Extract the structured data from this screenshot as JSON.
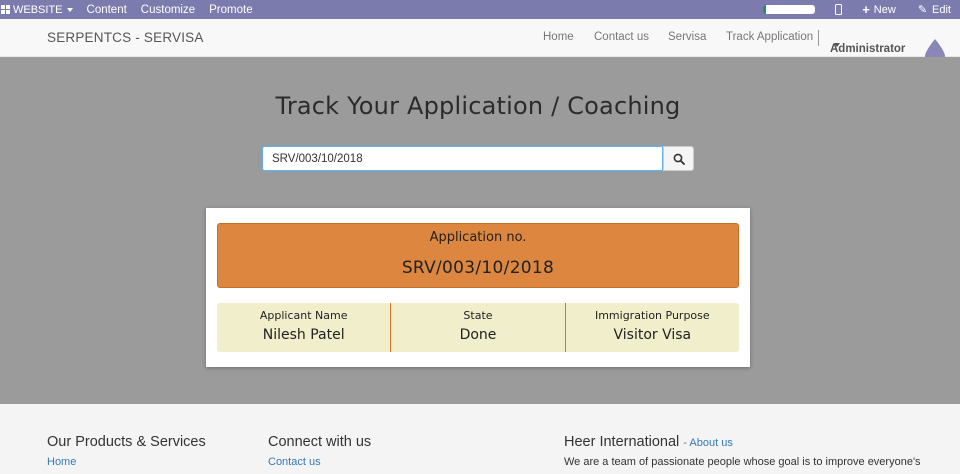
{
  "topbar": {
    "website_label": "WEBSITE",
    "menus": [
      "Content",
      "Customize",
      "Promote"
    ],
    "new_label": "New",
    "edit_label": "Edit"
  },
  "navbar": {
    "brand": "SERPENTCS - SERVISA",
    "links": [
      "Home",
      "Contact us",
      "Servisa",
      "Track Application"
    ],
    "user": "Administrator"
  },
  "hero": {
    "title": "Track Your Application / Coaching",
    "search_value": "SRV/003/10/2018"
  },
  "result": {
    "app_label": "Application no.",
    "app_number": "SRV/003/10/2018",
    "columns": [
      {
        "label": "Applicant Name",
        "value": "Nilesh Patel"
      },
      {
        "label": "State",
        "value": "Done"
      },
      {
        "label": "Immigration Purpose",
        "value": "Visitor Visa"
      }
    ]
  },
  "footer": {
    "col1_title": "Our Products & Services",
    "col1_link": "Home",
    "col2_title": "Connect with us",
    "col2_link": "Contact us",
    "col3_title": "Heer International",
    "col3_sub": "- About us",
    "col3_text": "We are a team of passionate people whose goal is to improve everyone's"
  },
  "colors": {
    "topbar": "#7c7bad",
    "hero_bg": "#9b9b9b",
    "app_box": "#dd8640",
    "info_row": "#f0eecb",
    "link": "#337ab7"
  }
}
